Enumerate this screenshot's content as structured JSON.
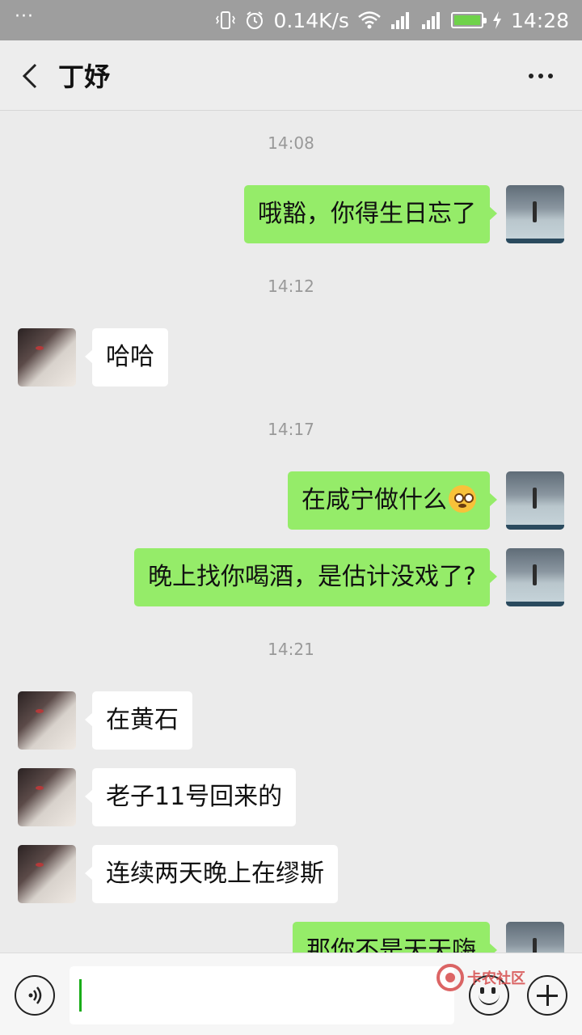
{
  "status_bar": {
    "menu_dots": "···",
    "network_speed": "0.14K/s",
    "time": "14:28",
    "battery_level": 1.0,
    "icons": [
      "vibrate-icon",
      "alarm-icon",
      "wifi-icon",
      "signal-icon",
      "signal-icon",
      "battery-icon",
      "charging-icon"
    ]
  },
  "header": {
    "title": "丁妤",
    "back_icon": "chevron-left-icon",
    "more_icon": "more-horizontal-icon"
  },
  "messages": [
    {
      "type": "timestamp",
      "text": "14:08"
    },
    {
      "type": "message",
      "sender": "self",
      "text": "哦豁，你得生日忘了"
    },
    {
      "type": "timestamp",
      "text": "14:12"
    },
    {
      "type": "message",
      "sender": "other",
      "text": "哈哈"
    },
    {
      "type": "timestamp",
      "text": "14:17"
    },
    {
      "type": "message",
      "sender": "self",
      "text": "在咸宁做什么",
      "emoji": "shocked-face-emoji"
    },
    {
      "type": "message",
      "sender": "self",
      "text": "晚上找你喝酒，是估计没戏了?"
    },
    {
      "type": "timestamp",
      "text": "14:21"
    },
    {
      "type": "message",
      "sender": "other",
      "text": "在黄石"
    },
    {
      "type": "message",
      "sender": "other",
      "text": "老子11号回来的"
    },
    {
      "type": "message",
      "sender": "other",
      "text": "连续两天晚上在缪斯"
    },
    {
      "type": "message",
      "sender": "self",
      "text": "那你不是天天嗨"
    }
  ],
  "input_bar": {
    "input_value": "",
    "voice_icon": "voice-icon",
    "emoji_icon": "emoji-icon",
    "plus_icon": "plus-icon"
  },
  "watermark": {
    "text": "卡农社区"
  },
  "colors": {
    "self_bubble": "#95ec69",
    "other_bubble": "#ffffff",
    "background": "#ebebeb",
    "caret": "#1aad19"
  }
}
